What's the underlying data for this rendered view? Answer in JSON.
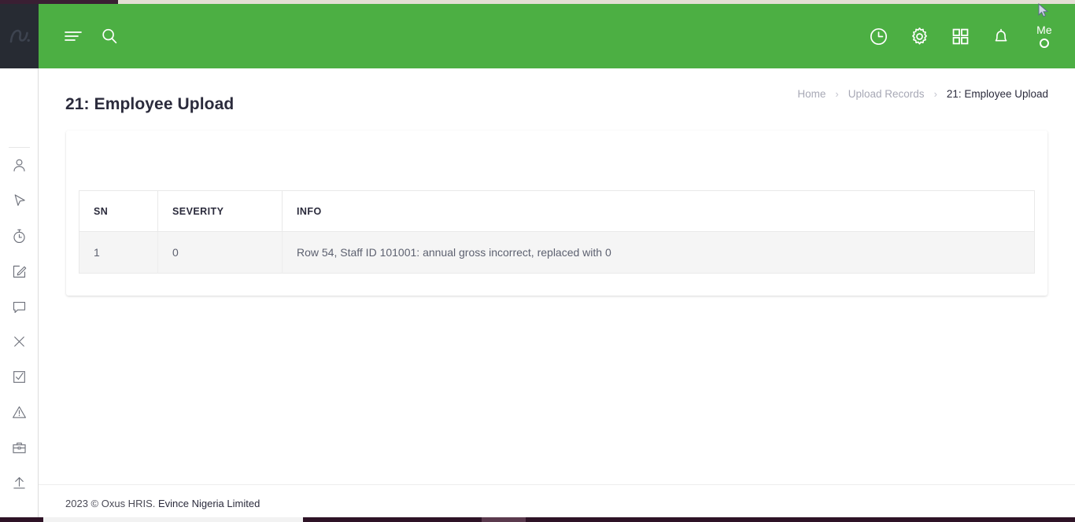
{
  "app": {
    "logo_name": "oxus-logo",
    "accent_green": "#4caf43",
    "sidebar_dark": "#272b33",
    "text_dark": "#2b2b3c",
    "muted_text": "#a7a8b5",
    "row_bg": "#f5f5f5"
  },
  "topbar": {
    "menu_toggle": "hamburger-menu-icon",
    "search": "search-icon",
    "history": "clock-icon",
    "settings": "gear-icon",
    "apps": "grid-apps-icon",
    "notifications": "bell-icon",
    "user_label": "Me"
  },
  "sidebar": {
    "items": [
      {
        "name": "sidebar-item-profile",
        "icon": "user-icon"
      },
      {
        "name": "sidebar-item-pointer",
        "icon": "cursor-arrow-icon"
      },
      {
        "name": "sidebar-item-timesheet",
        "icon": "stopwatch-icon"
      },
      {
        "name": "sidebar-item-edit",
        "icon": "edit-note-icon"
      },
      {
        "name": "sidebar-item-messages",
        "icon": "chat-bubble-icon"
      },
      {
        "name": "sidebar-item-close",
        "icon": "close-x-icon"
      },
      {
        "name": "sidebar-item-tasks",
        "icon": "checkbox-checked-icon"
      },
      {
        "name": "sidebar-item-alerts",
        "icon": "warning-triangle-icon"
      },
      {
        "name": "sidebar-item-jobs",
        "icon": "briefcase-icon"
      },
      {
        "name": "sidebar-item-upload",
        "icon": "upload-arrow-icon"
      }
    ]
  },
  "page": {
    "title": "21: Employee Upload",
    "breadcrumb": [
      {
        "label": "Home",
        "current": false
      },
      {
        "label": "Upload Records",
        "current": false
      },
      {
        "label": "21: Employee Upload",
        "current": true
      }
    ],
    "breadcrumb_separator": "›"
  },
  "table": {
    "columns": [
      "SN",
      "SEVERITY",
      "INFO"
    ],
    "rows": [
      {
        "sn": "1",
        "severity": "0",
        "info": "Row 54, Staff ID 101001: annual gross incorrect, replaced with 0"
      }
    ]
  },
  "footer": {
    "copyright": "2023 © Oxus HRIS.",
    "company": " Evince Nigeria Limited"
  }
}
